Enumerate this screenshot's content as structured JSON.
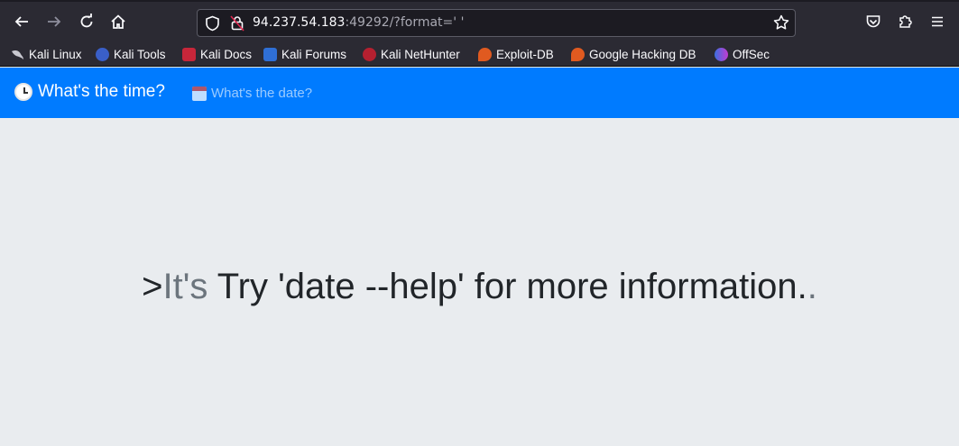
{
  "browser": {
    "url_host": "94.237.54.183",
    "url_rest": ":49292/?format=' '",
    "bookmarks": [
      {
        "label": "Kali Linux",
        "icon": "kali-dragon-icon"
      },
      {
        "label": "Kali Tools",
        "icon": "kali-tools-icon"
      },
      {
        "label": "Kali Docs",
        "icon": "kali-docs-icon"
      },
      {
        "label": "Kali Forums",
        "icon": "kali-forums-icon"
      },
      {
        "label": "Kali NetHunter",
        "icon": "nethunter-icon"
      },
      {
        "label": "Exploit-DB",
        "icon": "exploit-db-icon"
      },
      {
        "label": "Google Hacking DB",
        "icon": "ghdb-icon"
      },
      {
        "label": "OffSec",
        "icon": "offsec-icon"
      }
    ]
  },
  "navbar": {
    "brand": "What's the time?",
    "link": "What's the date?",
    "color": "#007bff"
  },
  "main": {
    "prefix": ">",
    "muted": "It's",
    "message": " Try 'date --help' for more information.",
    "suffix": "."
  }
}
